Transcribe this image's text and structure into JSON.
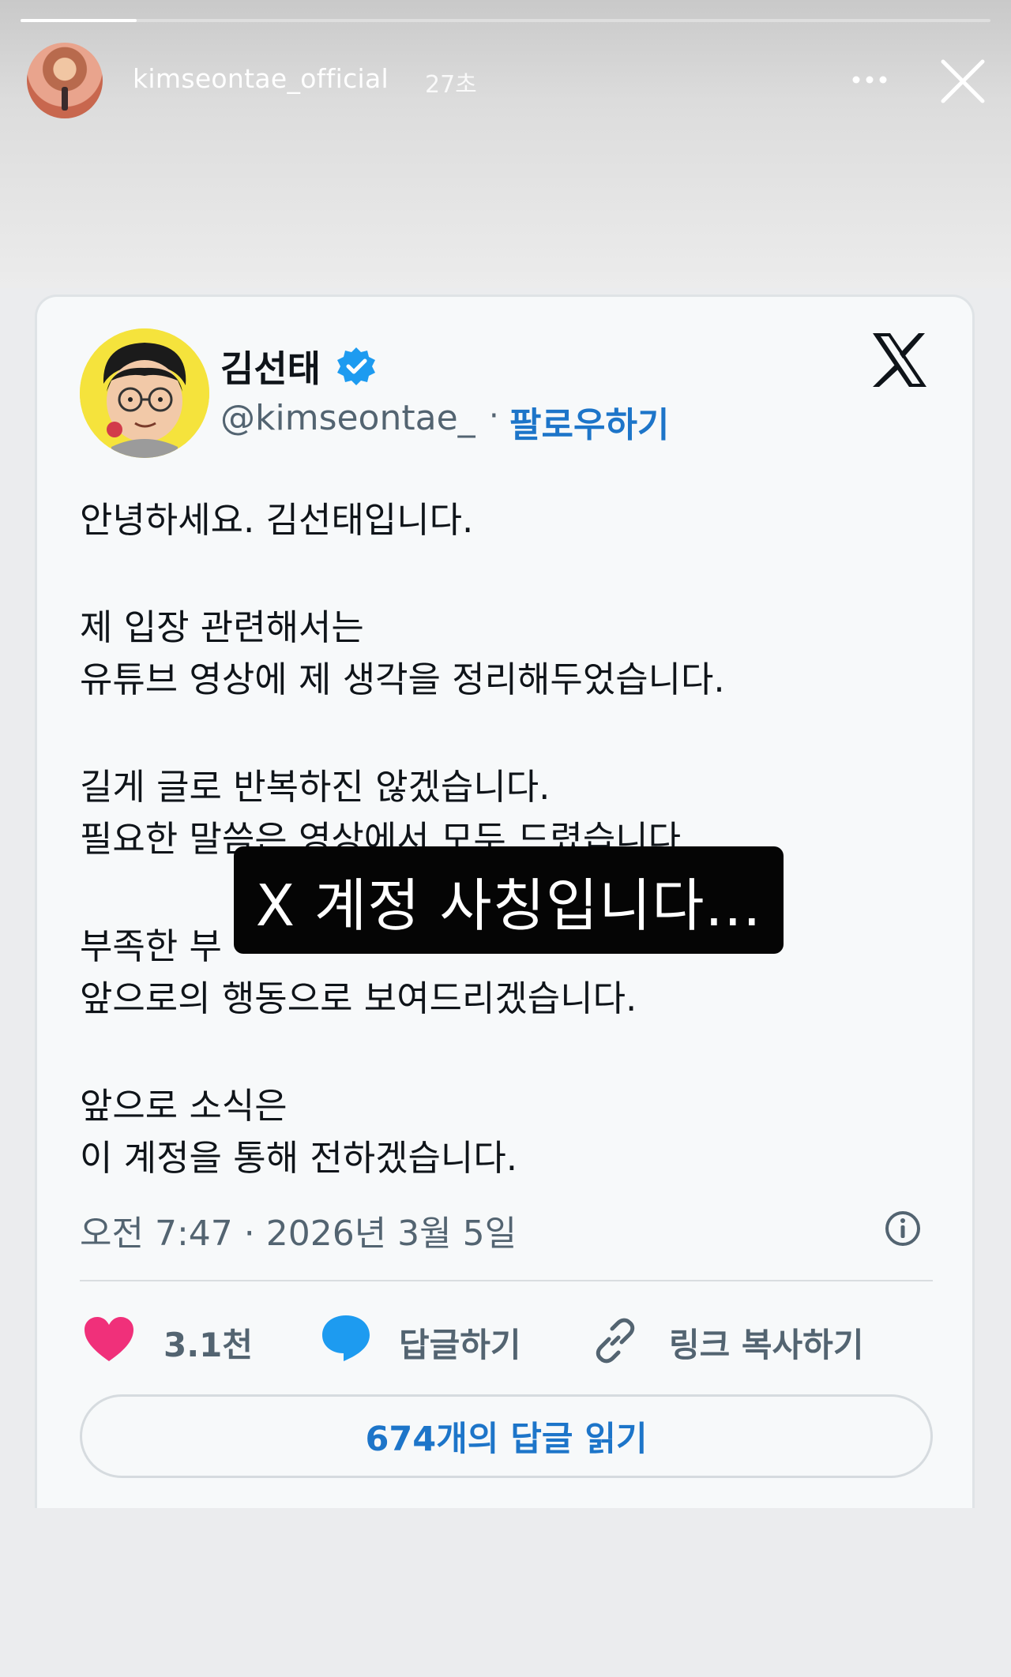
{
  "story": {
    "progress": 0.12,
    "username": "kimseontae_official",
    "time": "27초",
    "more_icon": "more-horizontal-icon",
    "close_icon": "close-icon"
  },
  "tweet": {
    "display_name": "김선태",
    "verified_icon": "verified-badge-icon",
    "handle": "@kimseontae_",
    "separator": "·",
    "follow_label": "팔로우하기",
    "platform_icon": "x-logo-icon",
    "lines": [
      "안녕하세요. 김선태입니다.",
      "제 입장 관련해서는",
      "유튜브 영상에 제 생각을 정리해두었습니다.",
      "길게 글로 반복하진 않겠습니다.",
      "필요한 말씀은 영상에서 모두 드렸습니다.",
      "부족한 부",
      "앞으로의 행동으로 보여드리겠습니다.",
      "앞으로 소식은",
      "이 계정을 통해 전하겠습니다."
    ],
    "timestamp": "오전 7:47 · 2026년 3월 5일",
    "info_icon": "info-icon",
    "likes": "3.1천",
    "like_icon": "heart-icon",
    "reply_label": "답글하기",
    "reply_icon": "comment-icon",
    "copy_link_label": "링크 복사하기",
    "link_icon": "link-icon",
    "read_replies_label": "674개의 답글 읽기"
  },
  "caption": {
    "text": "X 계정 사칭입니다..."
  },
  "colors": {
    "accent_blue": "#1d75c9",
    "like_pink": "#f0307a",
    "reply_blue": "#1d9bf0",
    "caption_bg": "#050505"
  }
}
